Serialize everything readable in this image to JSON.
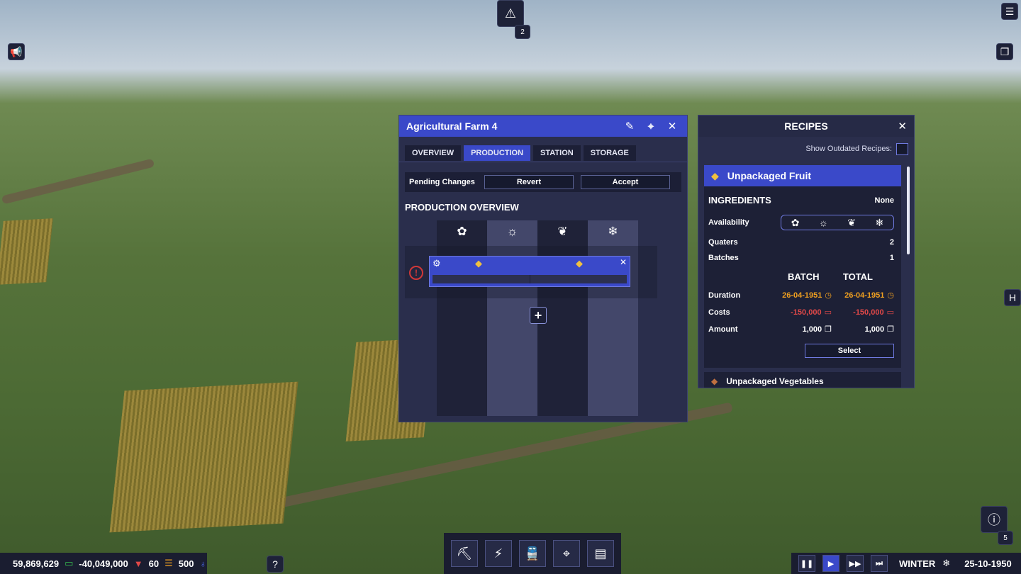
{
  "alerts": {
    "count": "2"
  },
  "production_window": {
    "title": "Agricultural Farm 4",
    "tabs": [
      {
        "label": "OVERVIEW"
      },
      {
        "label": "PRODUCTION"
      },
      {
        "label": "STATION"
      },
      {
        "label": "STORAGE"
      }
    ],
    "pending": {
      "label": "Pending Changes",
      "revert": "Revert",
      "accept": "Accept"
    },
    "section_title": "PRODUCTION OVERVIEW",
    "seasons": [
      "spring-icon",
      "summer-icon",
      "autumn-icon",
      "winter-icon"
    ]
  },
  "recipes_window": {
    "title": "RECIPES",
    "show_outdated_label": "Show Outdated Recipes:",
    "recipe": {
      "name": "Unpackaged Fruit",
      "ingredients_label": "INGREDIENTS",
      "ingredients_value": "None",
      "availability_label": "Availability",
      "quaters_label": "Quaters",
      "quaters_value": "2",
      "batches_label": "Batches",
      "batches_value": "1",
      "batch_header": "BATCH",
      "total_header": "TOTAL",
      "duration_label": "Duration",
      "duration_batch": "26-04-1951",
      "duration_total": "26-04-1951",
      "costs_label": "Costs",
      "costs_batch": "-150,000",
      "costs_total": "-150,000",
      "amount_label": "Amount",
      "amount_batch": "1,000",
      "amount_total": "1,000",
      "select_label": "Select"
    },
    "next_recipe": "Unpackaged Vegetables"
  },
  "status_bar": {
    "money": "59,869,629",
    "balance": "-40,049,000",
    "workers": "60",
    "research": "500",
    "season": "WINTER",
    "date": "25-10-1950"
  },
  "help_label": "?",
  "hotkey_label": "H",
  "notifications_count": "5",
  "colors": {
    "accent": "#3a49c9",
    "panel": "#2a2e4c",
    "warning": "#d03838",
    "cost": "#e04848",
    "duration": "#f0a020"
  }
}
